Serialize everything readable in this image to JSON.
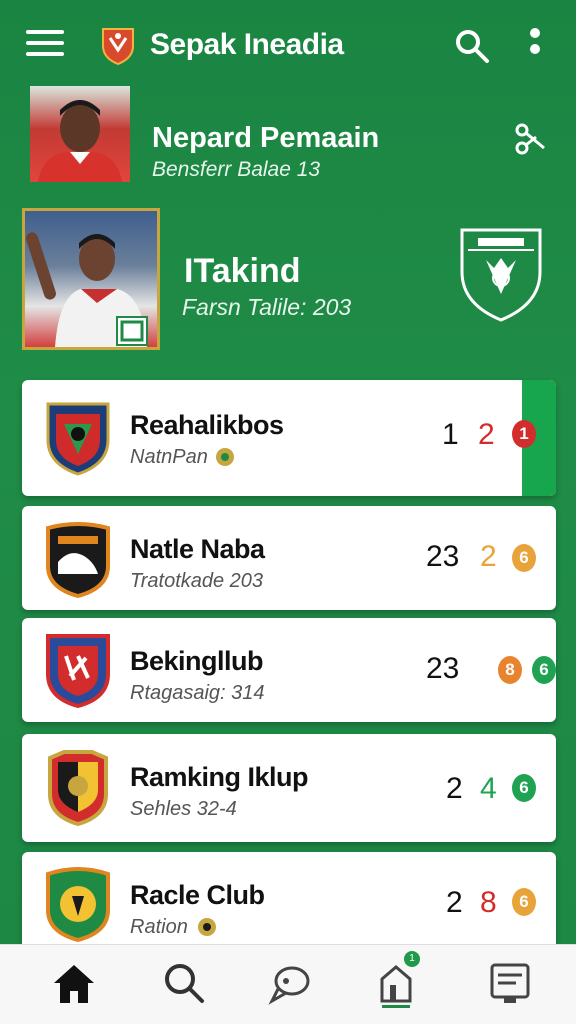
{
  "header": {
    "title": "Sepak Ineadia",
    "menu_icon": "hamburger-menu-icon",
    "search_icon": "search-icon",
    "more_icon": "more-vertical-icon"
  },
  "featured": [
    {
      "name": "Nepard Pemaain",
      "subtitle": "Bensferr Balae 13"
    },
    {
      "name": "ITakind",
      "subtitle": "Farsn Talile: 203"
    }
  ],
  "clubs": [
    {
      "name": "Reahalikbos",
      "subtitle": "NatnPan",
      "stat1": "1",
      "stat2": "2",
      "stat3": "1"
    },
    {
      "name": "Natle Naba",
      "subtitle": "Tratotkade 203",
      "stat1": "23",
      "stat2": "2",
      "stat3": "6"
    },
    {
      "name": "Bekingllub",
      "subtitle": "Rtagasaig: 314",
      "stat1": "23",
      "stat2": "8",
      "stat3": "6"
    },
    {
      "name": "Ramking Iklup",
      "subtitle": "Sehles 32-4",
      "stat1": "2",
      "stat2": "4",
      "stat3": "6"
    },
    {
      "name": "Racle Club",
      "subtitle": "Ration",
      "stat1": "2",
      "stat2": "8",
      "stat3": "6"
    }
  ],
  "nav": {
    "items": [
      "home-icon",
      "search-icon",
      "chat-icon",
      "stats-icon",
      "news-icon"
    ],
    "badge": "1"
  },
  "colors": {
    "primary": "#1f8a44",
    "accent_green": "#17a64e",
    "red": "#d22c2c",
    "orange": "#e8a33a",
    "green_dot": "#1fa353"
  }
}
